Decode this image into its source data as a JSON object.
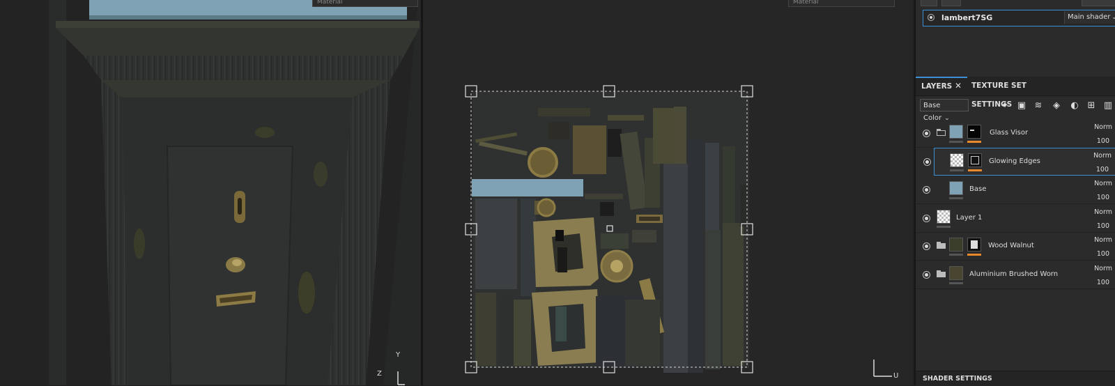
{
  "viewport3d": {
    "material_dropdown": "Material"
  },
  "viewport2d": {
    "material_dropdown": "Material"
  },
  "gizmo": {
    "axis_y": "Y",
    "axis_z": "Z",
    "axis_u": "U"
  },
  "texture_set": {
    "name": "lambert7SG",
    "shader": "Main shader"
  },
  "tabs": {
    "layers": "LAYERS",
    "texture_set_settings": "TEXTURE SET SETTINGS"
  },
  "toolbar": {
    "channel": "Base Color"
  },
  "layers": [
    {
      "name": "Glass Visor",
      "blend": "Norm",
      "opacity": "100"
    },
    {
      "name": "Glowing Edges",
      "blend": "Norm",
      "opacity": "100"
    },
    {
      "name": "Base",
      "blend": "Norm",
      "opacity": "100"
    },
    {
      "name": "Layer 1",
      "blend": "Norm",
      "opacity": "100"
    },
    {
      "name": "Wood Walnut",
      "blend": "Norm",
      "opacity": "100"
    },
    {
      "name": "Aluminium Brushed Worn",
      "blend": "Norm",
      "opacity": "100"
    }
  ],
  "shader_settings": {
    "title": "SHADER SETTINGS"
  },
  "icons": [
    "magic-wand-icon",
    "fill-layer-icon",
    "stack-layer-icon",
    "paint-bucket-icon",
    "mask-icon",
    "add-folder-icon",
    "trash-icon",
    "folder-icon",
    "eye-icon",
    "close-icon",
    "chevron-down-icon"
  ],
  "colors": {
    "accent": "#3d8fd6",
    "mask_underline": "#e8892b",
    "glass_blue": "#7fa2b4"
  }
}
